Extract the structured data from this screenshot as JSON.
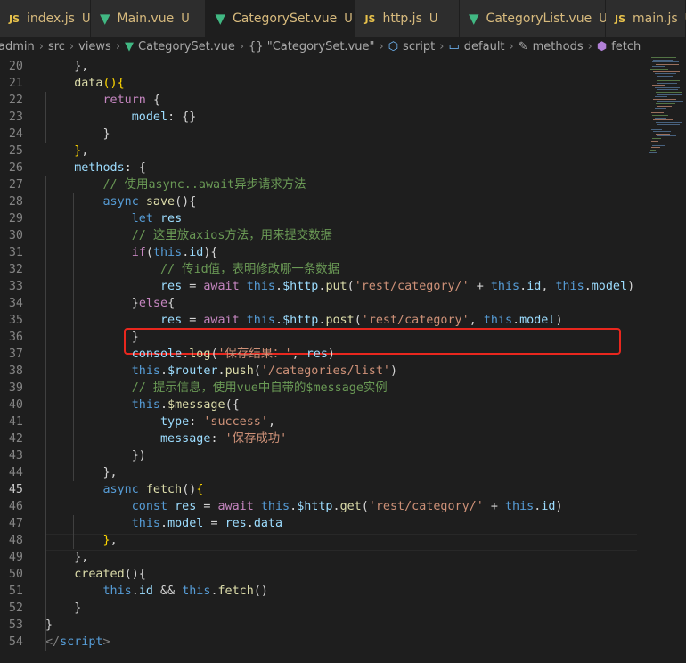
{
  "tabs": [
    {
      "icon": "JS",
      "label": "index.js",
      "status": "U"
    },
    {
      "icon": "V",
      "label": "Main.vue",
      "status": "U"
    },
    {
      "icon": "V",
      "label": "CategorySet.vue",
      "status": "U",
      "close": "×"
    },
    {
      "icon": "JS",
      "label": "http.js",
      "status": "U"
    },
    {
      "icon": "V",
      "label": "CategoryList.vue",
      "status": "U"
    },
    {
      "icon": "JS",
      "label": "main.js",
      "status": "U"
    }
  ],
  "breadcrumb": {
    "items": [
      "admin",
      "src",
      "views",
      "CategorySet.vue",
      "{} \"CategorySet.vue\"",
      "script",
      "default",
      "methods",
      "fetch"
    ],
    "sep": "›"
  },
  "lines": [
    {
      "n": "20",
      "html": "    <span class=p>},</span>"
    },
    {
      "n": "21",
      "html": "    <span class=f>data</span><span class=b>()</span><span class=b>{</span>"
    },
    {
      "n": "22",
      "html": "        <span class=k>return</span> <span class=p>{</span>"
    },
    {
      "n": "23",
      "html": "            <span class=v>model</span><span class=p>: {}</span>"
    },
    {
      "n": "24",
      "html": "        <span class=p>}</span>"
    },
    {
      "n": "25",
      "html": "    <span class=b>}</span><span class=p>,</span>"
    },
    {
      "n": "26",
      "html": "    <span class=v>methods</span><span class=p>: {</span>"
    },
    {
      "n": "27",
      "html": "        <span class=c>// 使用async..await异步请求方法</span>"
    },
    {
      "n": "28",
      "html": "        <span class=kb>async</span> <span class=f>save</span><span class=p>(){</span>"
    },
    {
      "n": "29",
      "html": "            <span class=kb>let</span> <span class=v>res</span>"
    },
    {
      "n": "30",
      "html": "            <span class=c>// 这里放axios方法，用来提交数据</span>"
    },
    {
      "n": "31",
      "html": "            <span class=k>if</span><span class=p>(</span><span class=kb>this</span><span class=p>.</span><span class=v>id</span><span class=p>){</span>"
    },
    {
      "n": "32",
      "html": "                <span class=c>// 传id值，表明修改哪一条数据</span>"
    },
    {
      "n": "33",
      "html": "                <span class=v>res</span> <span class=p>=</span> <span class=k>await</span> <span class=kb>this</span><span class=p>.</span><span class=v>$http</span><span class=p>.</span><span class=f>put</span><span class=p>(</span><span class=s>'rest/category/'</span> <span class=p>+</span> <span class=kb>this</span><span class=p>.</span><span class=v>id</span><span class=p>,</span> <span class=kb>this</span><span class=p>.</span><span class=v>model</span><span class=p>)</span>"
    },
    {
      "n": "34",
      "html": "            <span class=p>}</span><span class=k>else</span><span class=p>{</span>"
    },
    {
      "n": "35",
      "html": "                <span class=v>res</span> <span class=p>=</span> <span class=k>await</span> <span class=kb>this</span><span class=p>.</span><span class=v>$http</span><span class=p>.</span><span class=f>post</span><span class=p>(</span><span class=s>'rest/category'</span><span class=p>,</span> <span class=kb>this</span><span class=p>.</span><span class=v>model</span><span class=p>)</span>"
    },
    {
      "n": "36",
      "html": "            <span class=p>}</span>"
    },
    {
      "n": "37",
      "html": "            <span class=v>console</span><span class=p>.</span><span class=f>log</span><span class=p>(</span><span class=s>'保存结果：'</span><span class=p>,</span> <span class=v>res</span><span class=p>)</span>"
    },
    {
      "n": "38",
      "html": "            <span class=kb>this</span><span class=p>.</span><span class=v>$router</span><span class=p>.</span><span class=f>push</span><span class=p>(</span><span class=s>'/categories/list'</span><span class=p>)</span>"
    },
    {
      "n": "39",
      "html": "            <span class=c>// 提示信息，使用vue中自带的$message实例</span>"
    },
    {
      "n": "40",
      "html": "            <span class=kb>this</span><span class=p>.</span><span class=f>$message</span><span class=p>({</span>"
    },
    {
      "n": "41",
      "html": "                <span class=v>type</span><span class=p>:</span> <span class=s>'success'</span><span class=p>,</span>"
    },
    {
      "n": "42",
      "html": "                <span class=v>message</span><span class=p>:</span> <span class=s>'保存成功'</span>"
    },
    {
      "n": "43",
      "html": "            <span class=p>})</span>"
    },
    {
      "n": "44",
      "html": "        <span class=p>},</span>"
    },
    {
      "n": "45",
      "html": "        <span class=kb>async</span> <span class=f>fetch</span><span class=p>()</span><span class=b>{</span>"
    },
    {
      "n": "46",
      "html": "            <span class=kb>const</span> <span class=v>res</span> <span class=p>=</span> <span class=k>await</span> <span class=kb>this</span><span class=p>.</span><span class=v>$http</span><span class=p>.</span><span class=f>get</span><span class=p>(</span><span class=s>'rest/category/'</span> <span class=p>+</span> <span class=kb>this</span><span class=p>.</span><span class=v>id</span><span class=p>)</span>"
    },
    {
      "n": "47",
      "html": "            <span class=kb>this</span><span class=p>.</span><span class=v>model</span> <span class=p>=</span> <span class=v>res</span><span class=p>.</span><span class=v>data</span>"
    },
    {
      "n": "48",
      "html": "        <span class=b>}</span><span class=p>,</span>"
    },
    {
      "n": "49",
      "html": "    <span class=p>},</span>"
    },
    {
      "n": "50",
      "html": "    <span class=f>created</span><span class=p>(){</span>"
    },
    {
      "n": "51",
      "html": "        <span class=kb>this</span><span class=p>.</span><span class=v>id</span> <span class=p>&amp;&amp;</span> <span class=kb>this</span><span class=p>.</span><span class=f>fetch</span><span class=p>()</span>"
    },
    {
      "n": "52",
      "html": "    <span class=p>}</span>"
    },
    {
      "n": "53",
      "html": "<span class=p>}</span>"
    },
    {
      "n": "54",
      "html": "<span class=t>&lt;/</span><span class=kb>script</span><span class=t>&gt;</span>"
    }
  ],
  "current_line": "45",
  "highlighted_line": "33",
  "colors": {
    "accent_box": "#e8271e",
    "editor_bg": "#1e1e1e"
  }
}
